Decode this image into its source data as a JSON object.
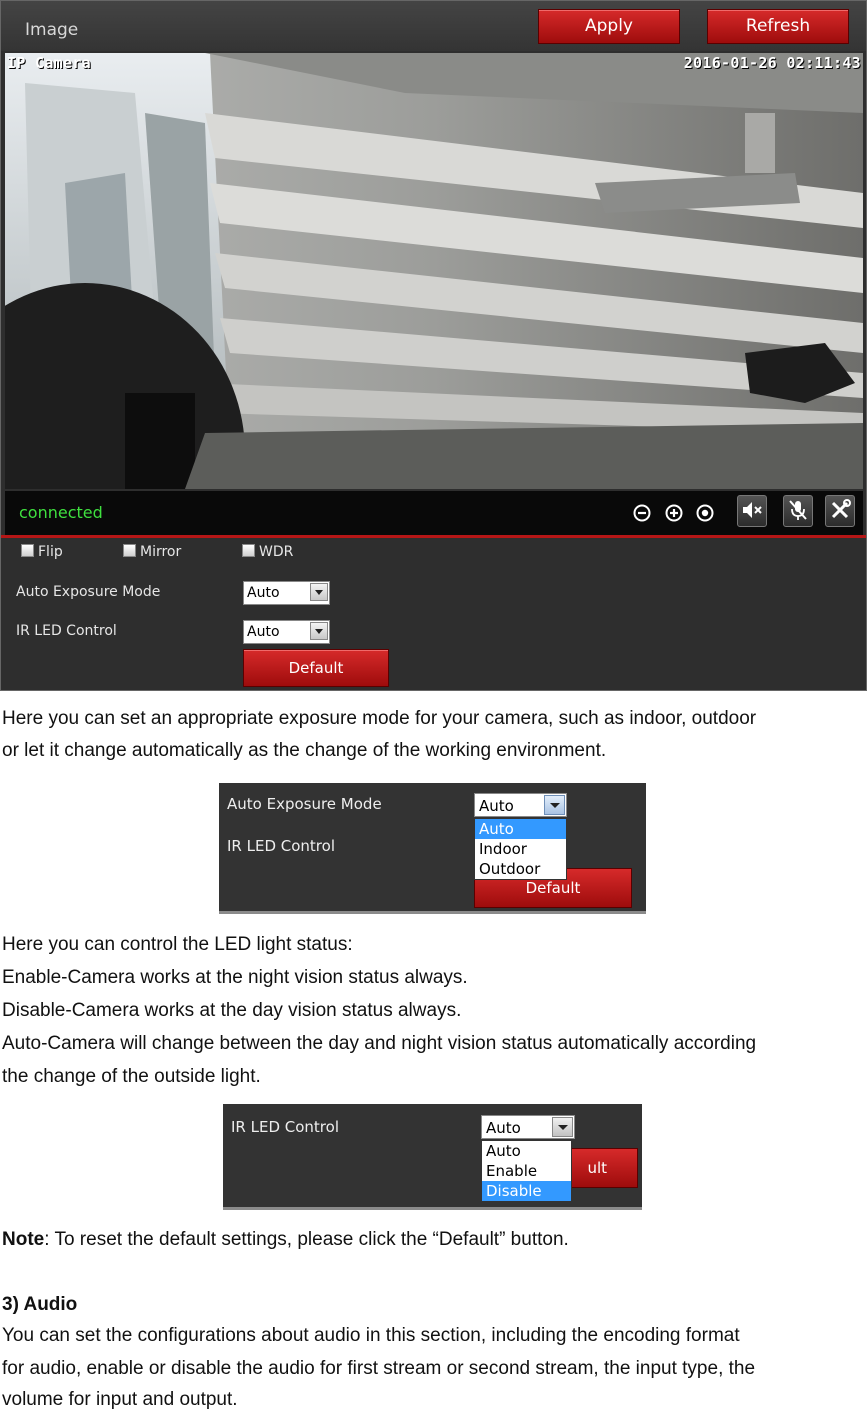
{
  "panel": {
    "title": "Image",
    "apply_label": "Apply",
    "refresh_label": "Refresh",
    "osd_name": "IP Camera",
    "osd_timestamp": "2016-01-26 02:11:43",
    "status": "connected",
    "status_color": "#3fe03f",
    "accent_color": "#b51616",
    "controls": [
      "zoom-out-icon",
      "zoom-in-icon",
      "record-icon",
      "mute-speaker-icon",
      "mute-microphone-icon",
      "settings-tools-icon"
    ],
    "checkboxes": [
      {
        "label": "Flip",
        "checked": false
      },
      {
        "label": "Mirror",
        "checked": false
      },
      {
        "label": "WDR",
        "checked": false
      }
    ],
    "auto_exposure_label": "Auto Exposure Mode",
    "auto_exposure_value": "Auto",
    "ir_led_label": "IR LED Control",
    "ir_led_value": "Auto",
    "default_label": "Default"
  },
  "text": {
    "p1_line1": "Here you can set an appropriate exposure mode for your camera, such as indoor, outdoor",
    "p1_line2": "or let it change automatically as the change of the working environment.",
    "p2": "Here you can control the LED light status:",
    "p3": "Enable-Camera works at the night vision status always.",
    "p4": "Disable-Camera works at the day vision status always.",
    "p5_line1": "Auto-Camera will change between the day and night vision status automatically according",
    "p5_line2": "the change of the outside light.",
    "note_label": "Note",
    "note_text": ": To reset the default settings, please click the “Default” button.",
    "section_heading": "3) Audio",
    "p6_line1": "You can set the configurations about audio in this section, including the encoding format",
    "p6_line2": "for audio, enable or disable the audio for first stream or second stream, the input type, the",
    "p6_line3": "volume for input and output."
  },
  "inset_exposure": {
    "label_exposure": "Auto Exposure Mode",
    "label_ir": "IR LED Control",
    "select_value": "Auto",
    "options": [
      "Auto",
      "Indoor",
      "Outdoor"
    ],
    "selected_option": "Auto",
    "button_label": "Default"
  },
  "inset_ir": {
    "label_ir": "IR LED Control",
    "select_value": "Auto",
    "options": [
      "Auto",
      "Enable",
      "Disable"
    ],
    "selected_option": "Disable",
    "button_partial_label": "ult"
  }
}
